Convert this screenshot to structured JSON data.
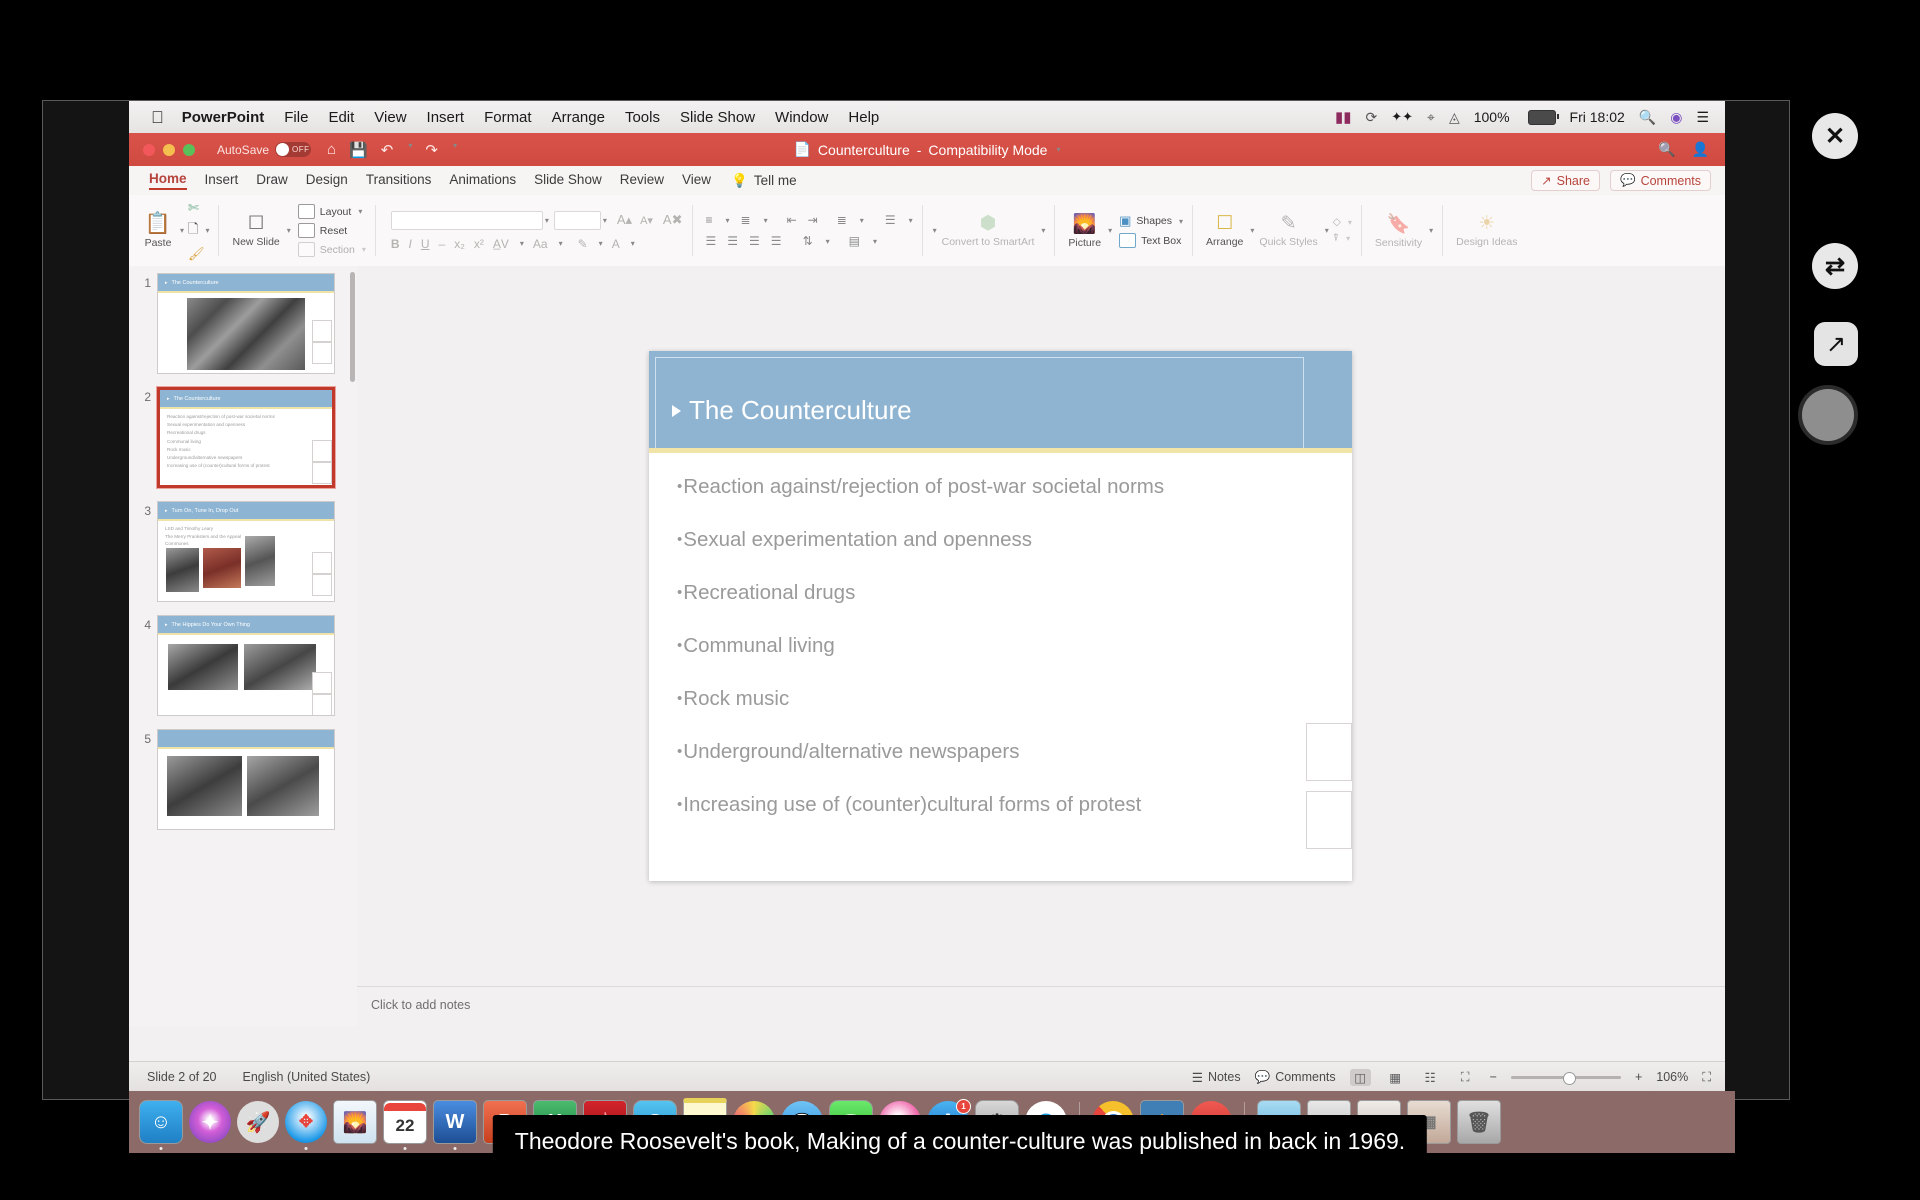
{
  "macbar": {
    "apple_icon": "apple-icon",
    "app": "PowerPoint",
    "menus": [
      "File",
      "Edit",
      "View",
      "Insert",
      "Format",
      "Arrange",
      "Tools",
      "Slide Show",
      "Window",
      "Help"
    ],
    "status": {
      "battery_percent": "100%",
      "clock": "Fri 18:02",
      "icons": [
        "bitwarden-icon",
        "timemachine-icon",
        "dropbox-icon",
        "bluetooth-icon",
        "wifi-icon",
        "battery-icon",
        "spotlight-icon",
        "siri-icon",
        "controlcenter-icon"
      ]
    }
  },
  "titlebar": {
    "autosave_label": "AutoSave",
    "autosave_state": "OFF",
    "document_title": "Counterculture",
    "mode": "Compatibility Mode",
    "icons": [
      "home-icon",
      "save-icon",
      "undo-icon",
      "redo-icon",
      "customize-icon"
    ],
    "right_icons": [
      "search-icon",
      "account-icon"
    ]
  },
  "ribbon": {
    "tabs": [
      {
        "label": "Home",
        "active": true
      },
      {
        "label": "Insert",
        "active": false
      },
      {
        "label": "Draw",
        "active": false
      },
      {
        "label": "Design",
        "active": false
      },
      {
        "label": "Transitions",
        "active": false
      },
      {
        "label": "Animations",
        "active": false
      },
      {
        "label": "Slide Show",
        "active": false
      },
      {
        "label": "Review",
        "active": false
      },
      {
        "label": "View",
        "active": false
      }
    ],
    "tell_me": "Tell me",
    "share": "Share",
    "comments": "Comments",
    "groups": {
      "paste": "Paste",
      "cut_icon": "scissors-icon",
      "copy_icon": "copy-icon",
      "format_painter_icon": "format-painter-icon",
      "new_slide": "New Slide",
      "layout": "Layout",
      "reset": "Reset",
      "section": "Section",
      "convert_smartart": "Convert to SmartArt",
      "picture": "Picture",
      "shapes": "Shapes",
      "text_box": "Text Box",
      "arrange": "Arrange",
      "quick_styles": "Quick Styles",
      "sensitivity": "Sensitivity",
      "design_ideas": "Design Ideas"
    }
  },
  "thumbnails": [
    {
      "number": "1",
      "title": "The Counterculture",
      "selected": false,
      "lines": [],
      "has_image": true
    },
    {
      "number": "2",
      "title": "The Counterculture",
      "selected": true,
      "lines": [
        "Reaction against/rejection of post-war societal norms",
        "Sexual experimentation and openness",
        "Recreational drugs",
        "Communal living",
        "Rock music",
        "Underground/alternative newspapers",
        "Increasing use of (counter)cultural forms of protest"
      ],
      "has_image": false
    },
    {
      "number": "3",
      "title": "Turn On, Tune In, Drop Out",
      "selected": false,
      "lines": [
        "LSD and Timothy Leary",
        "The Merry Pranksters and the Appeal",
        "Communes"
      ],
      "has_image": true
    },
    {
      "number": "4",
      "title": "The Hippies Do Your Own Thing",
      "selected": false,
      "lines": [],
      "has_image": true
    },
    {
      "number": "5",
      "title": "",
      "selected": false,
      "lines": [],
      "has_image": true
    }
  ],
  "slide": {
    "title": "The Counterculture",
    "bullets": [
      "Reaction against/rejection of post-war societal norms",
      "Sexual experimentation and openness",
      "Recreational drugs",
      "Communal living",
      "Rock music",
      "Underground/alternative newspapers",
      "Increasing use of (counter)cultural forms of protest"
    ],
    "title_bg": "#8fb4d1",
    "accent": "#f2e4a6"
  },
  "notes": {
    "placeholder": "Click to add notes"
  },
  "statusbar": {
    "slide_indicator": "Slide 2 of 20",
    "language": "English (United States)",
    "notes_label": "Notes",
    "comments_label": "Comments",
    "zoom_level": "106%",
    "views": [
      "normal-view-icon",
      "slide-sorter-icon",
      "reading-view-icon",
      "presenter-view-icon"
    ],
    "zoom_out": "−",
    "zoom_in": "+",
    "fit_icon": "fit-slide-icon"
  },
  "dock": {
    "items": [
      {
        "name": "finder",
        "label": "",
        "color": "#2d9fe0",
        "shape": "sq",
        "glyph": "☺",
        "running": true
      },
      {
        "name": "siri",
        "label": "",
        "color": "#b045c9",
        "shape": "circle",
        "glyph": "✦",
        "running": false
      },
      {
        "name": "launchpad",
        "label": "",
        "color": "#d8d8d8",
        "shape": "circle",
        "glyph": "🚀",
        "running": false
      },
      {
        "name": "safari",
        "label": "",
        "color": "#1a9ae8",
        "shape": "circle",
        "glyph": "🧭",
        "running": true
      },
      {
        "name": "preview",
        "label": "",
        "color": "#cfe3f2",
        "shape": "sq",
        "glyph": "🖼",
        "running": false
      },
      {
        "name": "calendar",
        "label": "22",
        "color": "#ffffff",
        "shape": "sq",
        "glyph": "22",
        "running": true
      },
      {
        "name": "word",
        "label": "W",
        "color": "#2b579a",
        "shape": "sq",
        "glyph": "W",
        "running": true
      },
      {
        "name": "powerpoint",
        "label": "P",
        "color": "#d24726",
        "shape": "sq",
        "glyph": "P",
        "running": true
      },
      {
        "name": "excel",
        "label": "X",
        "color": "#1e7145",
        "shape": "sq",
        "glyph": "X",
        "running": false
      },
      {
        "name": "acrobat",
        "label": "",
        "color": "#b0161c",
        "shape": "sq",
        "glyph": "A",
        "running": false
      },
      {
        "name": "skype-business",
        "label": "S",
        "color": "#2aa8e0",
        "shape": "sq",
        "glyph": "S",
        "running": false
      },
      {
        "name": "notes",
        "label": "",
        "color": "#fdf6cf",
        "shape": "sq",
        "glyph": "",
        "running": false
      },
      {
        "name": "photos",
        "label": "",
        "color": "#f0f0f0",
        "shape": "circle",
        "glyph": "❀",
        "running": false
      },
      {
        "name": "messages",
        "label": "",
        "color": "#4aa8e8",
        "shape": "circle",
        "glyph": "💬",
        "running": false
      },
      {
        "name": "facetime",
        "label": "",
        "color": "#4cd964",
        "shape": "sq",
        "glyph": "📹",
        "running": false
      },
      {
        "name": "itunes",
        "label": "",
        "color": "#f06fb0",
        "shape": "circle",
        "glyph": "♪",
        "running": false
      },
      {
        "name": "app-store",
        "label": "A",
        "color": "#1c8fe8",
        "shape": "circle",
        "glyph": "A",
        "badge": "1",
        "running": false
      },
      {
        "name": "system-preferences",
        "label": "",
        "color": "#9a9a9a",
        "shape": "sq",
        "glyph": "⚙",
        "running": false
      },
      {
        "name": "skype",
        "label": "S",
        "color": "#ffffff",
        "shape": "circle",
        "glyph": "S",
        "running": false
      },
      {
        "name": "separator",
        "label": "",
        "color": "",
        "shape": "sep",
        "glyph": "",
        "running": false
      },
      {
        "name": "chrome",
        "label": "",
        "color": "#ffffff",
        "shape": "circle",
        "glyph": "◉",
        "running": true
      },
      {
        "name": "microsoft-teams",
        "label": "",
        "color": "#4a80b5",
        "shape": "sq",
        "glyph": "✤",
        "running": true
      },
      {
        "name": "remote-desktop",
        "label": "",
        "color": "#e8453c",
        "shape": "circle",
        "glyph": "»",
        "running": false
      },
      {
        "name": "separator2",
        "label": "",
        "color": "",
        "shape": "sep",
        "glyph": "",
        "running": false
      },
      {
        "name": "downloads-folder",
        "label": "",
        "color": "#7fc8ea",
        "shape": "sq",
        "glyph": "📁",
        "running": false
      },
      {
        "name": "stack-photos",
        "label": "",
        "color": "#cfcfcf",
        "shape": "sq",
        "glyph": "▤",
        "running": false
      },
      {
        "name": "stack-documents",
        "label": "",
        "color": "#d8d8d8",
        "shape": "sq",
        "glyph": "▤",
        "running": false
      },
      {
        "name": "stack-misc",
        "label": "",
        "color": "#e0d6cf",
        "shape": "sq",
        "glyph": "▤",
        "running": false
      },
      {
        "name": "trash",
        "label": "",
        "color": "#cfcfcf",
        "shape": "sq",
        "glyph": "🗑",
        "running": false
      }
    ]
  },
  "overlay": {
    "close": "✕",
    "swap": "⇄",
    "expand": "↗",
    "record": "record-button"
  },
  "caption": {
    "text": "Theodore Roosevelt's book, Making of a counter-culture was published in back in 1969."
  }
}
